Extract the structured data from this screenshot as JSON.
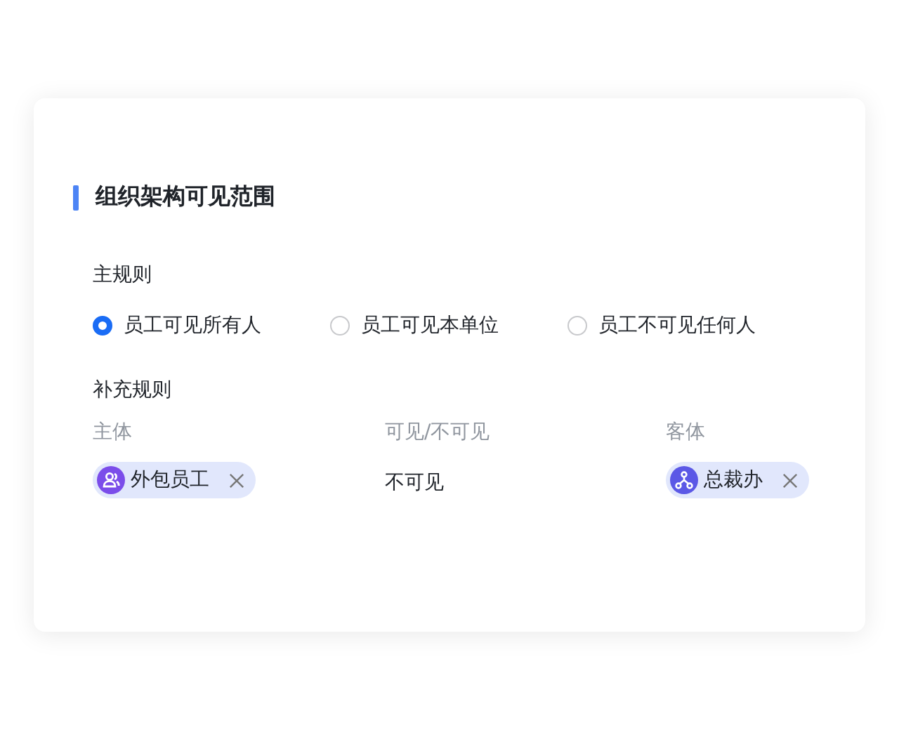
{
  "section": {
    "title": "组织架构可见范围"
  },
  "main_rule": {
    "label": "主规则",
    "options": [
      {
        "label": "员工可见所有人",
        "selected": true
      },
      {
        "label": "员工可见本单位",
        "selected": false
      },
      {
        "label": "员工不可见任何人",
        "selected": false
      }
    ]
  },
  "extra_rule": {
    "label": "补充规则",
    "columns": [
      "主体",
      "可见/不可见",
      "客体"
    ],
    "rows": [
      {
        "subject": {
          "label": "外包员工",
          "kind": "users"
        },
        "visibility": "不可见",
        "object": {
          "label": "总裁办",
          "kind": "org"
        }
      }
    ]
  }
}
